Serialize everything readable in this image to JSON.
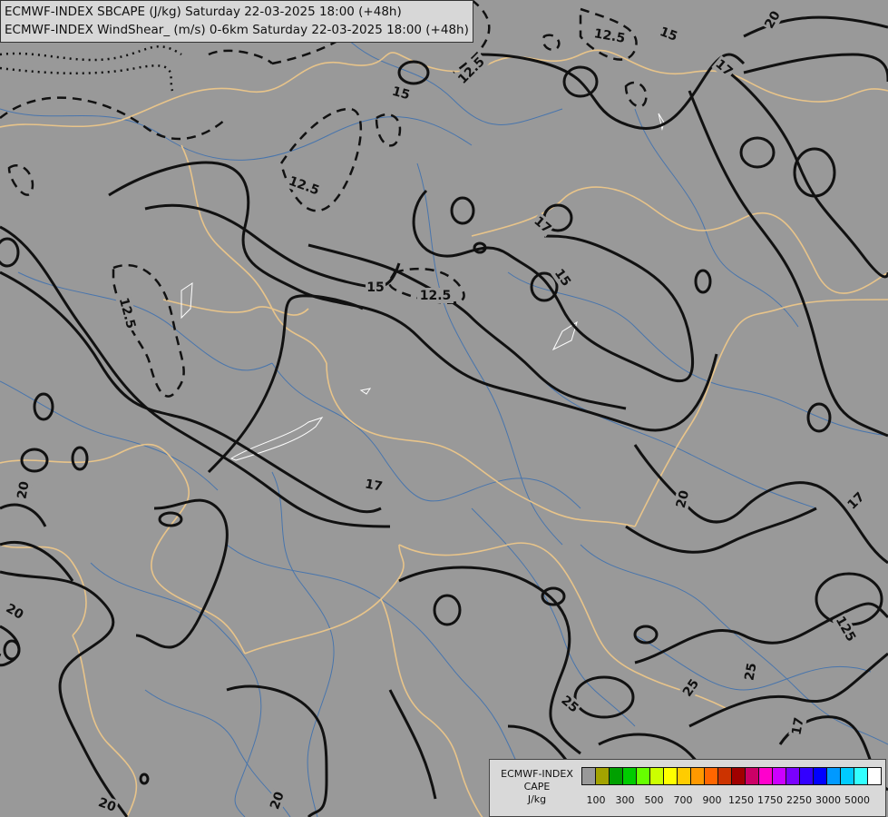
{
  "header": {
    "line1": "ECMWF-INDEX SBCAPE (J/kg) Saturday 22-03-2025 18:00 (+48h)",
    "line2": "ECMWF-INDEX WindShear_ (m/s) 0-6km Saturday 22-03-2025 18:00 (+48h)"
  },
  "legend": {
    "title1": "ECMWF-INDEX",
    "title2": "CAPE",
    "unit": "J/kg",
    "colors": [
      "#999999",
      "#a3a300",
      "#00a000",
      "#00cc00",
      "#66ff00",
      "#ccff00",
      "#ffff00",
      "#ffcc00",
      "#ff9900",
      "#ff6600",
      "#cc3300",
      "#a00000",
      "#cc0066",
      "#ff00cc",
      "#cc00ff",
      "#7a00ff",
      "#3300ff",
      "#0000ff",
      "#0099ff",
      "#00ccff",
      "#33ffff",
      "#ffffff"
    ],
    "ticks": [
      "100",
      "300",
      "500",
      "700",
      "900",
      "1250",
      "1750",
      "2250",
      "3000",
      "5000"
    ]
  },
  "contour_labels": [
    {
      "text": "20"
    },
    {
      "text": "12.5"
    },
    {
      "text": "15"
    },
    {
      "text": "17"
    },
    {
      "text": "12.5"
    },
    {
      "text": "15"
    },
    {
      "text": "12.5"
    },
    {
      "text": "15"
    },
    {
      "text": "12.5"
    },
    {
      "text": "17"
    },
    {
      "text": "20"
    },
    {
      "text": "17"
    },
    {
      "text": "20"
    },
    {
      "text": "20"
    },
    {
      "text": "125"
    },
    {
      "text": "25"
    },
    {
      "text": "25"
    },
    {
      "text": "25"
    },
    {
      "text": "17"
    },
    {
      "text": "20"
    },
    {
      "text": "20"
    },
    {
      "text": "12.5"
    },
    {
      "text": "15"
    }
  ],
  "colors": {
    "background": "#999999",
    "borders": "#e8c48a",
    "rivers": "#3b6fb0",
    "contours": "#111111"
  }
}
